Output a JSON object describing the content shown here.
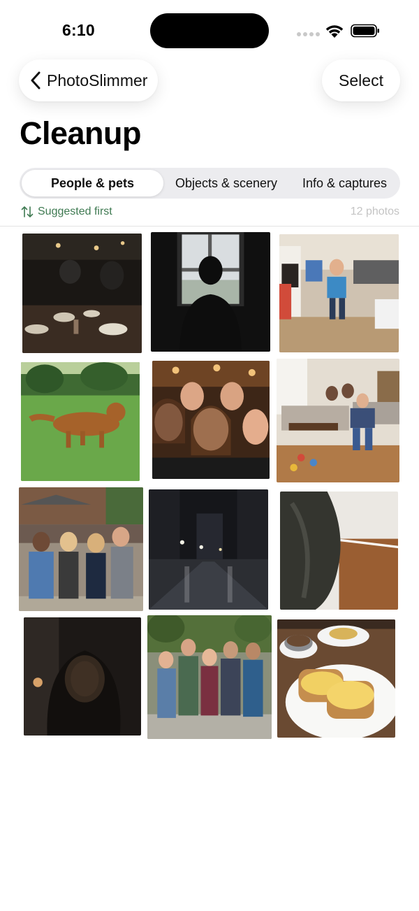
{
  "status_bar": {
    "time": "6:10"
  },
  "nav": {
    "back_label": "PhotoSlimmer",
    "select_label": "Select"
  },
  "page_title": "Cleanup",
  "segments": [
    "People & pets",
    "Objects & scenery",
    "Info & captures"
  ],
  "active_segment": "People & pets",
  "sort_label": "Suggested first",
  "photo_count": "12 photos",
  "accent_color": "#3f7a52",
  "photos": [
    {
      "subject": "dim restaurant dinner"
    },
    {
      "subject": "silhouette at window"
    },
    {
      "subject": "child running in living room"
    },
    {
      "subject": "dog running on grass"
    },
    {
      "subject": "group selfie in bar"
    },
    {
      "subject": "child running in living room"
    },
    {
      "subject": "group of four friends outdoors"
    },
    {
      "subject": "dark city street at night"
    },
    {
      "subject": "blurry accidental floor photo"
    },
    {
      "subject": "dark portrait"
    },
    {
      "subject": "group of five friends in park"
    },
    {
      "subject": "breakfast plate with eggs and coffee"
    }
  ]
}
